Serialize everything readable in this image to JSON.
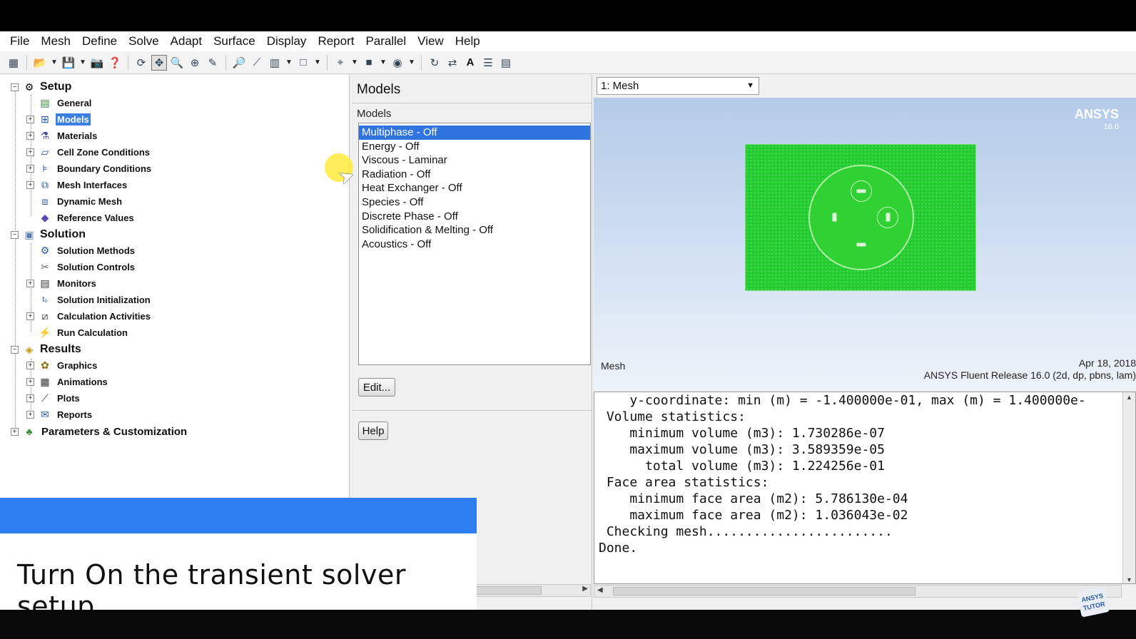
{
  "menubar": {
    "items": [
      "File",
      "Mesh",
      "Define",
      "Solve",
      "Adapt",
      "Surface",
      "Display",
      "Report",
      "Parallel",
      "View",
      "Help"
    ]
  },
  "toolbar": {
    "icons": [
      "new-icon",
      "open-icon",
      "save-icon",
      "print-icon",
      "help-icon",
      "rotate-icon",
      "translate-icon",
      "zoom-icon",
      "zoom-in-icon",
      "probe-icon",
      "zoom-fit-icon",
      "ruler-icon",
      "layout-icon",
      "window-icon",
      "select-icon",
      "display-icon",
      "view-icon",
      "refresh-icon",
      "sync-icon",
      "annotate-icon",
      "align-icon",
      "grid-icon"
    ]
  },
  "tree": {
    "setup": {
      "label": "Setup",
      "items": [
        "General",
        "Models",
        "Materials",
        "Cell Zone Conditions",
        "Boundary Conditions",
        "Mesh Interfaces",
        "Dynamic Mesh",
        "Reference Values"
      ]
    },
    "solution": {
      "label": "Solution",
      "items": [
        "Solution Methods",
        "Solution Controls",
        "Monitors",
        "Solution Initialization",
        "Calculation Activities",
        "Run Calculation"
      ]
    },
    "results": {
      "label": "Results",
      "items": [
        "Graphics",
        "Animations",
        "Plots",
        "Reports"
      ]
    },
    "parameters": {
      "label": "Parameters & Customization"
    },
    "selected": "Models"
  },
  "models_panel": {
    "title": "Models",
    "list_label": "Models",
    "items": [
      "Multiphase - Off",
      "Energy - Off",
      "Viscous - Laminar",
      "Radiation - Off",
      "Heat Exchanger - Off",
      "Species - Off",
      "Discrete Phase - Off",
      "Solidification & Melting - Off",
      "Acoustics - Off"
    ],
    "selected_index": 0,
    "edit_label": "Edit...",
    "help_label": "Help"
  },
  "viewport": {
    "selector": "1: Mesh",
    "logo": "ANSYS",
    "logo_version": "16.0",
    "label": "Mesh",
    "date": "Apr 18, 2018",
    "release": "ANSYS Fluent Release 16.0 (2d, dp, pbns, lam)",
    "mesh_color": "#22cc2f",
    "background_top": "#b4cbe8"
  },
  "console": {
    "lines": [
      "    y-coordinate: min (m) = -1.400000e-01, max (m) = 1.400000e-",
      " Volume statistics:",
      "    minimum volume (m3): 1.730286e-07",
      "    maximum volume (m3): 3.589359e-05",
      "      total volume (m3): 1.224256e-01",
      " Face area statistics:",
      "    minimum face area (m2): 5.786130e-04",
      "    maximum face area (m2): 1.036043e-02",
      " Checking mesh........................",
      "Done."
    ]
  },
  "caption": {
    "text": "Turn On the transient solver setup",
    "accent_color": "#2f7ef0"
  },
  "watermark": {
    "text": "ANSYS TUTOR"
  }
}
